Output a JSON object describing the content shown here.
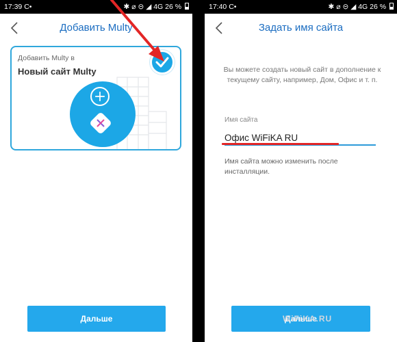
{
  "left": {
    "status": {
      "time": "17:39",
      "carrier": "С•",
      "icons": "✱ ⌀ ⊝ ◢ 4G",
      "battery": "26 %"
    },
    "title": "Добавить Multy",
    "card": {
      "subtitle": "Добавить Multy в",
      "name": "Новый сайт Multy"
    },
    "button_label": "Дальше"
  },
  "right": {
    "status": {
      "time": "17:40",
      "carrier": "С•",
      "icons": "✱ ⌀ ⊝ ◢ 4G",
      "battery": "26 %"
    },
    "title": "Задать имя сайта",
    "description": "Вы можете создать новый сайт в дополнение к текущему сайту, например, Дом, Офис и т. п.",
    "field_label": "Имя сайта",
    "field_value": "Офис WiFiKA RU",
    "hint": "Имя сайта можно изменить после инсталляции.",
    "button_label": "Дальше"
  },
  "watermark": "WiFiKA.RU",
  "colors": {
    "accent": "#1ca7e6",
    "title": "#1b6dc1",
    "button": "#24a8ec",
    "annotation": "#e32626"
  },
  "icons": [
    "back-chevron-icon",
    "check-icon",
    "plus-icon",
    "multy-device-icon",
    "building-icon",
    "battery-icon"
  ]
}
